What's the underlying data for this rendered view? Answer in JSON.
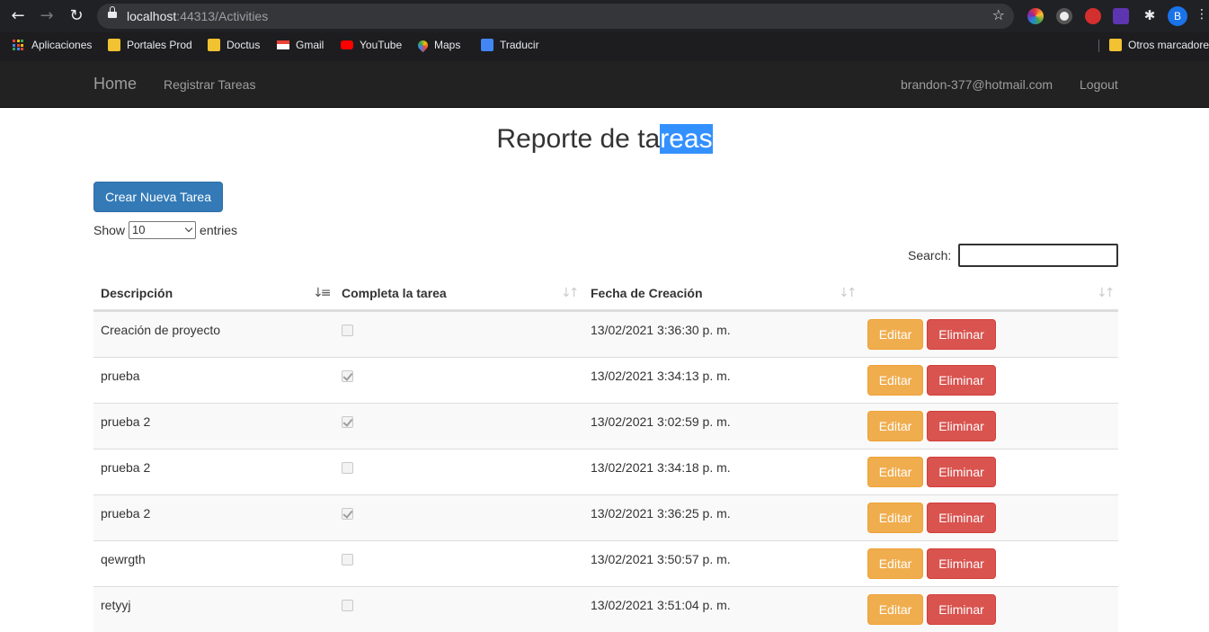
{
  "browser": {
    "url_host": "localhost",
    "url_path": ":44313/Activities",
    "profile_initial": "B",
    "bookmarks": [
      {
        "label": "Aplicaciones",
        "icon": "apps-grid-icon"
      },
      {
        "label": "Portales Prod",
        "icon": "folder-icon"
      },
      {
        "label": "Doctus",
        "icon": "folder-icon"
      },
      {
        "label": "Gmail",
        "icon": "gmail-icon"
      },
      {
        "label": "YouTube",
        "icon": "youtube-icon"
      },
      {
        "label": "Maps",
        "icon": "maps-icon"
      },
      {
        "label": "Traducir",
        "icon": "translate-icon"
      }
    ],
    "other_bookmarks": "Otros marcadores"
  },
  "navbar": {
    "brand": "Home",
    "link_register": "Registrar Tareas",
    "user_email": "brandon-377@hotmail.com",
    "logout": "Logout"
  },
  "page": {
    "title_plain": "Reporte de ta",
    "title_selected": "reas",
    "new_button": "Crear Nueva Tarea",
    "show_label": "Show",
    "entries_value": "10",
    "entries_label": "entries",
    "search_label": "Search:",
    "search_value": ""
  },
  "table": {
    "headers": [
      "Descripción",
      "Completa la tarea",
      "Fecha de Creación",
      ""
    ],
    "sorted_column": "Descripción",
    "rows": [
      {
        "description": "Creación de proyecto",
        "completed": false,
        "created": "13/02/2021 3:36:30 p. m."
      },
      {
        "description": "prueba",
        "completed": true,
        "created": "13/02/2021 3:34:13 p. m."
      },
      {
        "description": "prueba 2",
        "completed": true,
        "created": "13/02/2021 3:02:59 p. m."
      },
      {
        "description": "prueba 2",
        "completed": false,
        "created": "13/02/2021 3:34:18 p. m."
      },
      {
        "description": "prueba 2",
        "completed": true,
        "created": "13/02/2021 3:36:25 p. m."
      },
      {
        "description": "qewrgth",
        "completed": false,
        "created": "13/02/2021 3:50:57 p. m."
      },
      {
        "description": "retyyj",
        "completed": false,
        "created": "13/02/2021 3:51:04 p. m."
      }
    ],
    "edit_label": "Editar",
    "delete_label": "Eliminar"
  },
  "colors": {
    "primary": "#337ab7",
    "warning": "#f0ad4e",
    "danger": "#d9534f",
    "navbar": "#222222",
    "selection": "#3390ff"
  }
}
